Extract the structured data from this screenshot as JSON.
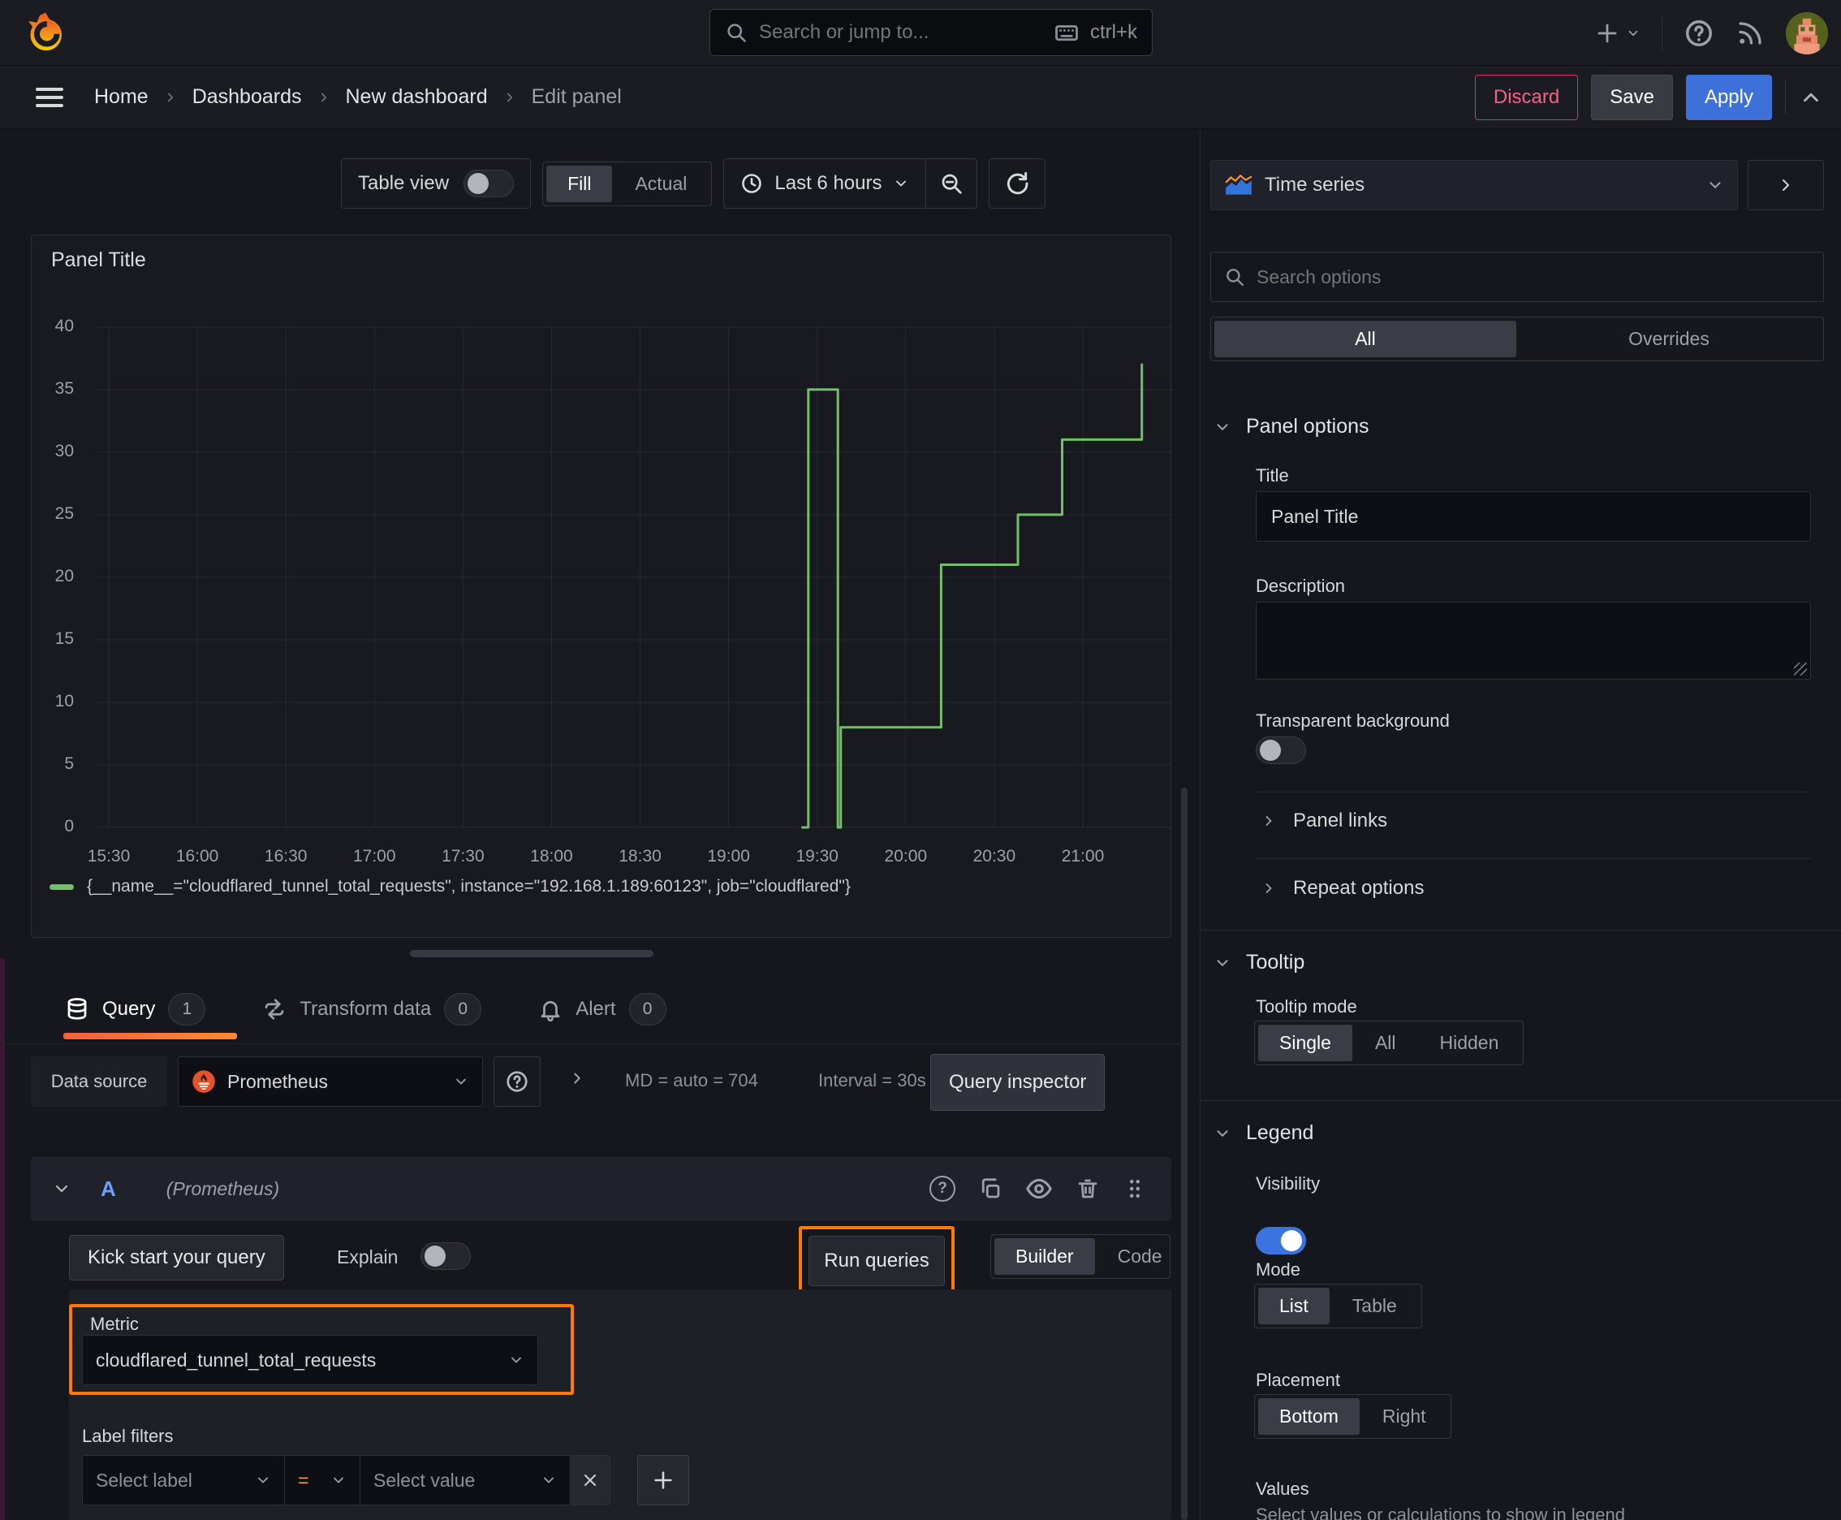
{
  "topbar": {
    "search_placeholder": "Search or jump to...",
    "search_shortcut": "ctrl+k"
  },
  "breadcrumb": {
    "items": [
      "Home",
      "Dashboards",
      "New dashboard",
      "Edit panel"
    ]
  },
  "actions": {
    "discard": "Discard",
    "save": "Save",
    "apply": "Apply"
  },
  "toolbar": {
    "table_view": "Table view",
    "fill": "Fill",
    "actual": "Actual",
    "time_range": "Last 6 hours"
  },
  "viz_picker": {
    "label": "Time series"
  },
  "options": {
    "search_placeholder": "Search options",
    "tabs": {
      "all": "All",
      "overrides": "Overrides"
    },
    "panel_options": {
      "title": "Panel options",
      "title_label": "Title",
      "title_value": "Panel Title",
      "description_label": "Description",
      "transparent_label": "Transparent background"
    },
    "panel_links": "Panel links",
    "repeat_options": "Repeat options",
    "tooltip": {
      "title": "Tooltip",
      "mode_label": "Tooltip mode",
      "modes": [
        "Single",
        "All",
        "Hidden"
      ]
    },
    "legend": {
      "title": "Legend",
      "visibility_label": "Visibility",
      "mode_label": "Mode",
      "modes": [
        "List",
        "Table"
      ],
      "placement_label": "Placement",
      "placements": [
        "Bottom",
        "Right"
      ],
      "values_label": "Values",
      "values_help": "Select values or calculations to show in legend"
    }
  },
  "panel": {
    "title": "Panel Title"
  },
  "chart_data": {
    "type": "line",
    "title": "Panel Title",
    "line_color": "#73bf69",
    "grid": true,
    "x_ticks": [
      "15:30",
      "16:00",
      "16:30",
      "17:00",
      "17:30",
      "18:00",
      "18:30",
      "19:00",
      "19:30",
      "20:00",
      "20:30",
      "21:00"
    ],
    "y_ticks": [
      0,
      5,
      10,
      15,
      20,
      25,
      30,
      35,
      40
    ],
    "ylim": [
      0,
      40
    ],
    "series": [
      {
        "name": "{__name__=\"cloudflared_tunnel_total_requests\", instance=\"192.168.1.189:60123\", job=\"cloudflared\"}",
        "step": true,
        "points": [
          [
            "19:25",
            0
          ],
          [
            "19:27",
            35
          ],
          [
            "19:37",
            0
          ],
          [
            "19:38",
            8
          ],
          [
            "20:12",
            21
          ],
          [
            "20:38",
            25
          ],
          [
            "20:53",
            31
          ],
          [
            "21:20",
            37
          ]
        ]
      }
    ]
  },
  "query_tabs": {
    "query": "Query",
    "query_count": "1",
    "transform": "Transform data",
    "transform_count": "0",
    "alert": "Alert",
    "alert_count": "0"
  },
  "datasource": {
    "label": "Data source",
    "name": "Prometheus",
    "stats_md": "MD = auto = 704",
    "stats_interval": "Interval = 30s",
    "inspector": "Query inspector"
  },
  "query_row": {
    "ref_id": "A",
    "ds_hint": "(Prometheus)"
  },
  "query_actions": {
    "kickstart": "Kick start your query",
    "explain": "Explain",
    "run": "Run queries",
    "builder": "Builder",
    "code": "Code"
  },
  "metric": {
    "label": "Metric",
    "value": "cloudflared_tunnel_total_requests"
  },
  "label_filters": {
    "label": "Label filters",
    "select_label": "Select label",
    "operator": "=",
    "select_value": "Select value"
  },
  "icons": {
    "search": "magnifier",
    "keyboard": "keyboard",
    "plus": "+",
    "help": "?",
    "news": "rss",
    "clock": "clock",
    "zoom_out": "magnifier-minus",
    "refresh": "circular-arrows",
    "query": "database",
    "transform": "swap-arrows",
    "alert": "bell",
    "copy": "duplicate",
    "eye": "eye",
    "trash": "trash",
    "drag": "grip-dots",
    "close": "x"
  },
  "colors": {
    "accent_orange": "#ff780a",
    "apply_blue": "#3d71d9",
    "discard_pink": "#e02f6e",
    "series_green": "#73bf69",
    "toggle_on_blue": "#3b73e0"
  }
}
